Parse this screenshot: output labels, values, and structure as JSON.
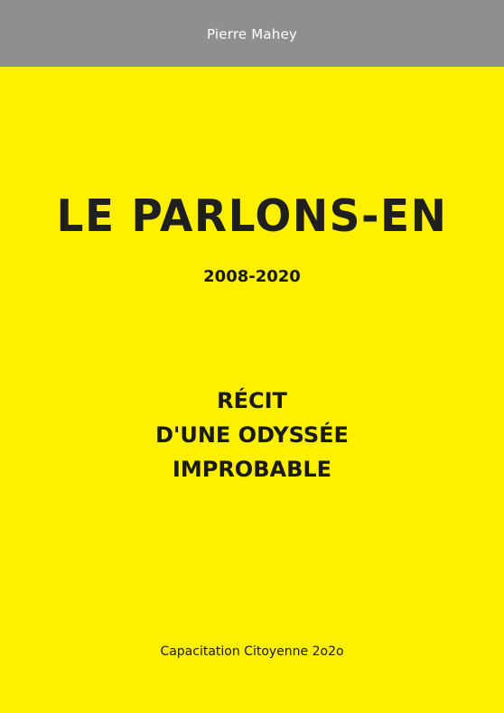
{
  "author": "Pierre Mahey",
  "title": "LE PARLONS-EN",
  "years": "2008-2020",
  "subtitle_lines": [
    "RÉCIT",
    "D'UNE ODYSSÉE",
    "IMPROBABLE"
  ],
  "publisher": "Capacitation Citoyenne 2o2o",
  "colors": {
    "background": "#fff000",
    "author_bar": "#8e8f91",
    "text": "#1a1a1a"
  }
}
